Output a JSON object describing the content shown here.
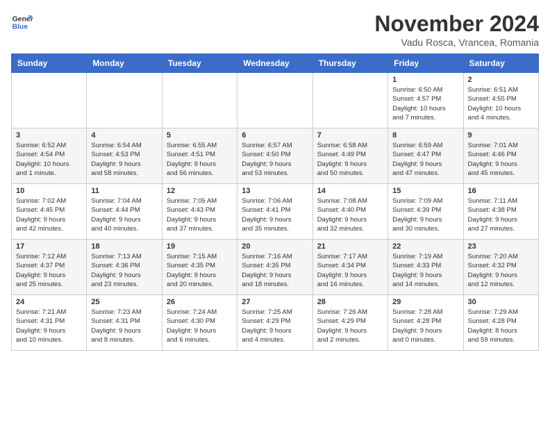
{
  "logo": {
    "line1": "General",
    "line2": "Blue"
  },
  "title": "November 2024",
  "location": "Vadu Rosca, Vrancea, Romania",
  "weekdays": [
    "Sunday",
    "Monday",
    "Tuesday",
    "Wednesday",
    "Thursday",
    "Friday",
    "Saturday"
  ],
  "weeks": [
    [
      {
        "day": "",
        "info": ""
      },
      {
        "day": "",
        "info": ""
      },
      {
        "day": "",
        "info": ""
      },
      {
        "day": "",
        "info": ""
      },
      {
        "day": "",
        "info": ""
      },
      {
        "day": "1",
        "info": "Sunrise: 6:50 AM\nSunset: 4:57 PM\nDaylight: 10 hours\nand 7 minutes."
      },
      {
        "day": "2",
        "info": "Sunrise: 6:51 AM\nSunset: 4:55 PM\nDaylight: 10 hours\nand 4 minutes."
      }
    ],
    [
      {
        "day": "3",
        "info": "Sunrise: 6:52 AM\nSunset: 4:54 PM\nDaylight: 10 hours\nand 1 minute."
      },
      {
        "day": "4",
        "info": "Sunrise: 6:54 AM\nSunset: 4:53 PM\nDaylight: 9 hours\nand 58 minutes."
      },
      {
        "day": "5",
        "info": "Sunrise: 6:55 AM\nSunset: 4:51 PM\nDaylight: 9 hours\nand 56 minutes."
      },
      {
        "day": "6",
        "info": "Sunrise: 6:57 AM\nSunset: 4:50 PM\nDaylight: 9 hours\nand 53 minutes."
      },
      {
        "day": "7",
        "info": "Sunrise: 6:58 AM\nSunset: 4:49 PM\nDaylight: 9 hours\nand 50 minutes."
      },
      {
        "day": "8",
        "info": "Sunrise: 6:59 AM\nSunset: 4:47 PM\nDaylight: 9 hours\nand 47 minutes."
      },
      {
        "day": "9",
        "info": "Sunrise: 7:01 AM\nSunset: 4:46 PM\nDaylight: 9 hours\nand 45 minutes."
      }
    ],
    [
      {
        "day": "10",
        "info": "Sunrise: 7:02 AM\nSunset: 4:45 PM\nDaylight: 9 hours\nand 42 minutes."
      },
      {
        "day": "11",
        "info": "Sunrise: 7:04 AM\nSunset: 4:44 PM\nDaylight: 9 hours\nand 40 minutes."
      },
      {
        "day": "12",
        "info": "Sunrise: 7:05 AM\nSunset: 4:43 PM\nDaylight: 9 hours\nand 37 minutes."
      },
      {
        "day": "13",
        "info": "Sunrise: 7:06 AM\nSunset: 4:41 PM\nDaylight: 9 hours\nand 35 minutes."
      },
      {
        "day": "14",
        "info": "Sunrise: 7:08 AM\nSunset: 4:40 PM\nDaylight: 9 hours\nand 32 minutes."
      },
      {
        "day": "15",
        "info": "Sunrise: 7:09 AM\nSunset: 4:39 PM\nDaylight: 9 hours\nand 30 minutes."
      },
      {
        "day": "16",
        "info": "Sunrise: 7:11 AM\nSunset: 4:38 PM\nDaylight: 9 hours\nand 27 minutes."
      }
    ],
    [
      {
        "day": "17",
        "info": "Sunrise: 7:12 AM\nSunset: 4:37 PM\nDaylight: 9 hours\nand 25 minutes."
      },
      {
        "day": "18",
        "info": "Sunrise: 7:13 AM\nSunset: 4:36 PM\nDaylight: 9 hours\nand 23 minutes."
      },
      {
        "day": "19",
        "info": "Sunrise: 7:15 AM\nSunset: 4:35 PM\nDaylight: 9 hours\nand 20 minutes."
      },
      {
        "day": "20",
        "info": "Sunrise: 7:16 AM\nSunset: 4:35 PM\nDaylight: 9 hours\nand 18 minutes."
      },
      {
        "day": "21",
        "info": "Sunrise: 7:17 AM\nSunset: 4:34 PM\nDaylight: 9 hours\nand 16 minutes."
      },
      {
        "day": "22",
        "info": "Sunrise: 7:19 AM\nSunset: 4:33 PM\nDaylight: 9 hours\nand 14 minutes."
      },
      {
        "day": "23",
        "info": "Sunrise: 7:20 AM\nSunset: 4:32 PM\nDaylight: 9 hours\nand 12 minutes."
      }
    ],
    [
      {
        "day": "24",
        "info": "Sunrise: 7:21 AM\nSunset: 4:31 PM\nDaylight: 9 hours\nand 10 minutes."
      },
      {
        "day": "25",
        "info": "Sunrise: 7:23 AM\nSunset: 4:31 PM\nDaylight: 9 hours\nand 8 minutes."
      },
      {
        "day": "26",
        "info": "Sunrise: 7:24 AM\nSunset: 4:30 PM\nDaylight: 9 hours\nand 6 minutes."
      },
      {
        "day": "27",
        "info": "Sunrise: 7:25 AM\nSunset: 4:29 PM\nDaylight: 9 hours\nand 4 minutes."
      },
      {
        "day": "28",
        "info": "Sunrise: 7:26 AM\nSunset: 4:29 PM\nDaylight: 9 hours\nand 2 minutes."
      },
      {
        "day": "29",
        "info": "Sunrise: 7:28 AM\nSunset: 4:28 PM\nDaylight: 9 hours\nand 0 minutes."
      },
      {
        "day": "30",
        "info": "Sunrise: 7:29 AM\nSunset: 4:28 PM\nDaylight: 8 hours\nand 59 minutes."
      }
    ]
  ]
}
